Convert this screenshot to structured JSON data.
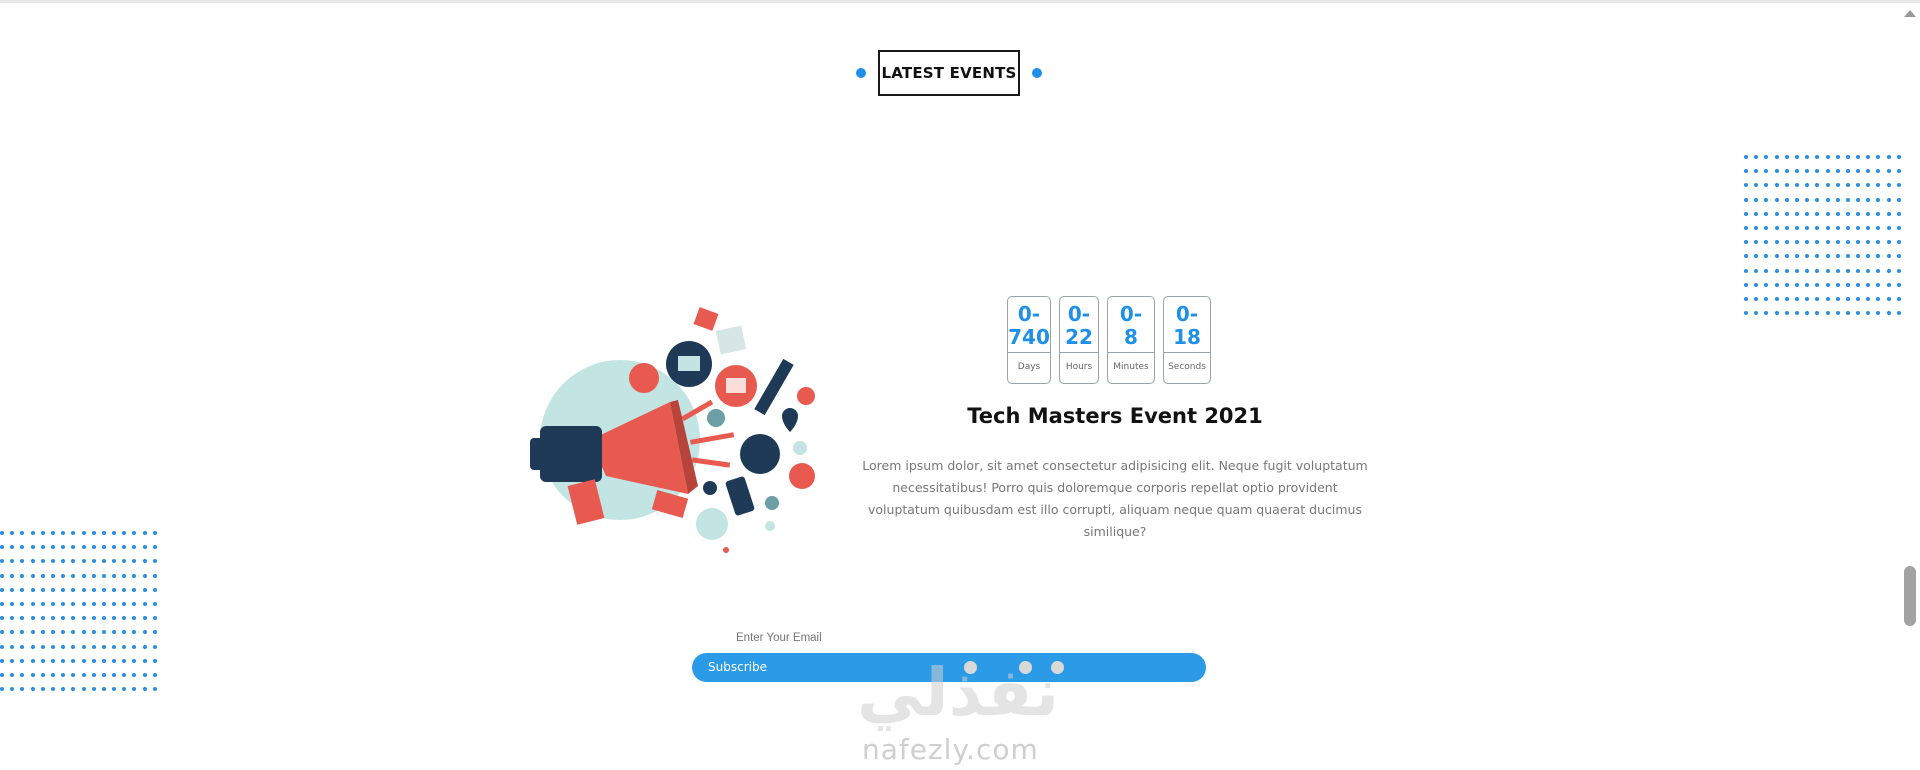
{
  "section": {
    "heading": "LATEST EVENTS"
  },
  "colors": {
    "accent": "#1e90e8",
    "subscribe_bar": "#2b9be8",
    "megaphone_red": "#e85a4f",
    "navy": "#1f3a57",
    "circle_bg": "#c2e4e2"
  },
  "countdown": [
    {
      "value": "0-\n740",
      "label": "Days"
    },
    {
      "value": "0-\n22",
      "label": "Hours"
    },
    {
      "value": "0-\n8",
      "label": "Minutes"
    },
    {
      "value": "0-\n18",
      "label": "Seconds"
    }
  ],
  "event": {
    "title": "Tech Masters Event 2021",
    "description": "Lorem ipsum dolor, sit amet consectetur adipisicing elit. Neque fugit voluptatum necessitatibus! Porro quis doloremque corporis repellat optio provident voluptatum quibusdam est illo corrupti, aliquam neque quam quaerat ducimus similique?"
  },
  "subscribe": {
    "email_placeholder": "Enter Your Email",
    "button_label": "Subscribe"
  },
  "watermark": {
    "arabic": "نفذلي",
    "latin": "nafezly.com"
  },
  "icons": {
    "illustration": "megaphone-illustration-icon",
    "scroll_up": "caret-up-icon"
  }
}
